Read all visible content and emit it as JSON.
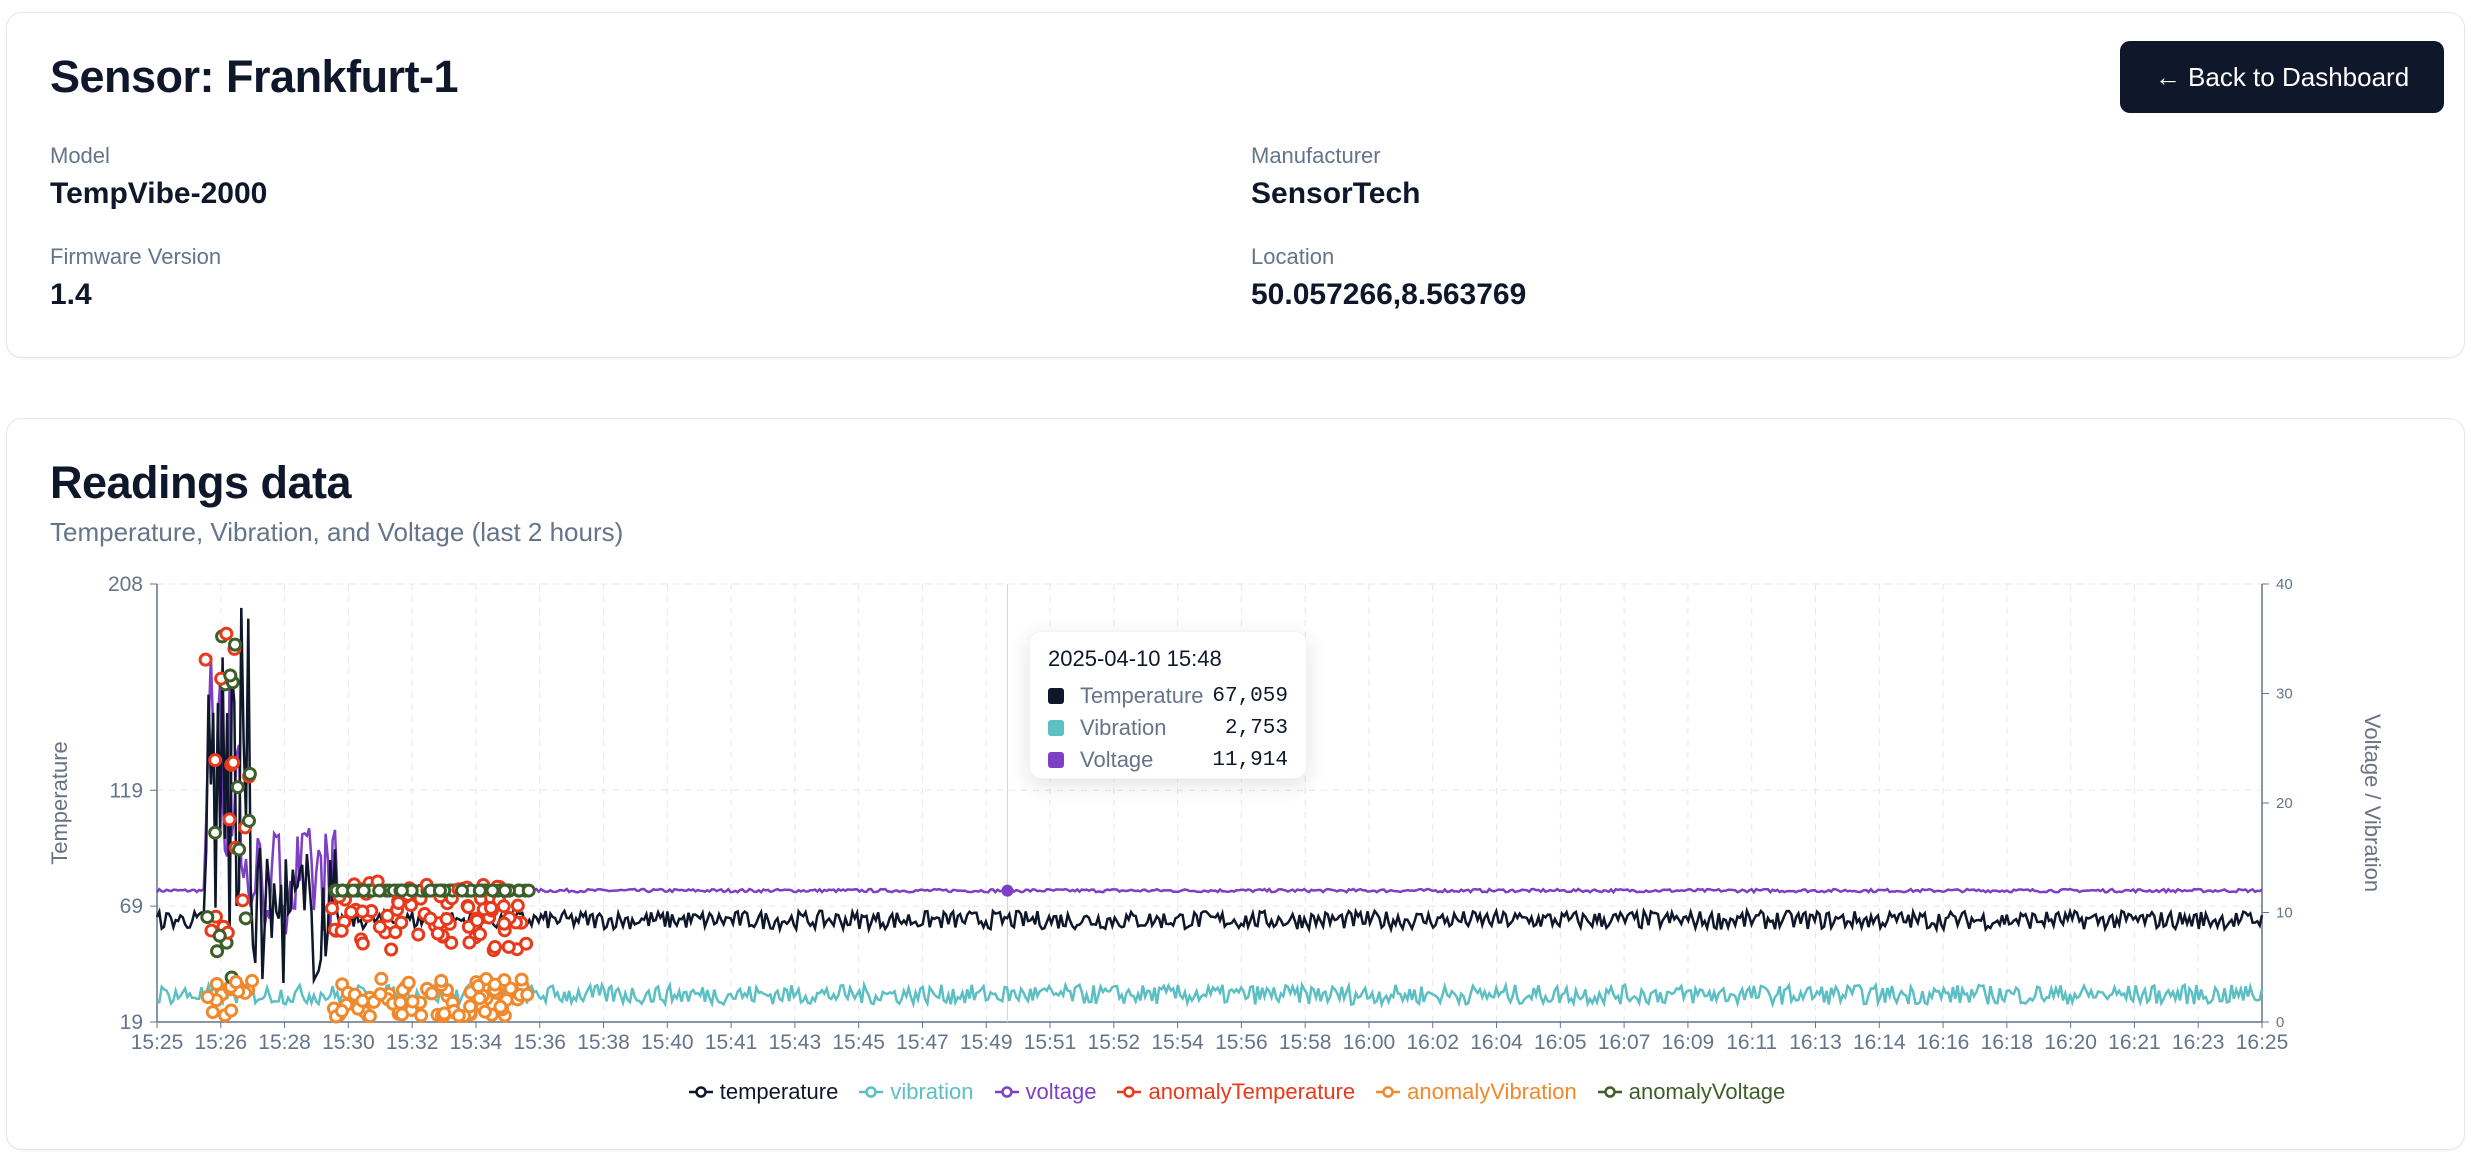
{
  "sensor": {
    "title": "Sensor: Frankfurt-1",
    "back_label": "← Back to Dashboard",
    "fields": {
      "model": {
        "label": "Model",
        "value": "TempVibe-2000"
      },
      "manufacturer": {
        "label": "Manufacturer",
        "value": "SensorTech"
      },
      "firmware": {
        "label": "Firmware Version",
        "value": "1.4"
      },
      "location": {
        "label": "Location",
        "value": "50.057266,8.563769"
      }
    }
  },
  "readings": {
    "title": "Readings data",
    "subtitle": "Temperature, Vibration, and Voltage (last 2 hours)"
  },
  "chart_data": {
    "type": "line",
    "ylabel_left": "Temperature",
    "ylabel_right": "Voltage / Vibration",
    "y_left_ticks": [
      "208",
      "119",
      "69",
      "19"
    ],
    "y_right_ticks": [
      "40",
      "30",
      "20",
      "10",
      "0"
    ],
    "ylim_left": [
      19,
      208
    ],
    "ylim_right": [
      0,
      40
    ],
    "x_ticks": [
      "15:25",
      "15:26",
      "15:28",
      "15:30",
      "15:32",
      "15:34",
      "15:36",
      "15:38",
      "15:40",
      "15:41",
      "15:43",
      "15:45",
      "15:47",
      "15:49",
      "15:51",
      "15:52",
      "15:54",
      "15:56",
      "15:58",
      "16:00",
      "16:02",
      "16:04",
      "16:05",
      "16:07",
      "16:09",
      "16:11",
      "16:13",
      "16:14",
      "16:16",
      "16:18",
      "16:20",
      "16:21",
      "16:23",
      "16:25"
    ],
    "grid": true,
    "series": [
      {
        "name": "temperature",
        "color": "#0f172a",
        "axis": "left",
        "approx_level": 63,
        "noise": 4
      },
      {
        "name": "vibration",
        "color": "#5bbfc4",
        "axis": "right",
        "approx_level": 2.5,
        "noise": 0.9
      },
      {
        "name": "voltage",
        "color": "#7e3fc4",
        "axis": "right",
        "approx_level": 12,
        "noise": 0.15
      },
      {
        "name": "anomalyTemperature",
        "color": "#e8391b",
        "axis": "left"
      },
      {
        "name": "anomalyVibration",
        "color": "#f0882c",
        "axis": "right"
      },
      {
        "name": "anomalyVoltage",
        "color": "#3c5e28",
        "axis": "right"
      }
    ],
    "tooltip": {
      "title": "2025-04-10 15:48",
      "rows": [
        {
          "name": "Temperature",
          "value": "67,059",
          "color": "#0f172a"
        },
        {
          "name": "Vibration",
          "value": "2,753",
          "color": "#5bbfc4"
        },
        {
          "name": "Voltage",
          "value": "11,914",
          "color": "#7e3fc4"
        }
      ]
    },
    "legend": [
      {
        "name": "temperature",
        "color": "#0f172a",
        "text_color": "#0f172a"
      },
      {
        "name": "vibration",
        "color": "#5bbfc4",
        "text_color": "#5bbfc4"
      },
      {
        "name": "voltage",
        "color": "#7e3fc4",
        "text_color": "#7e3fc4"
      },
      {
        "name": "anomalyTemperature",
        "color": "#e8391b",
        "text_color": "#e8391b"
      },
      {
        "name": "anomalyVibration",
        "color": "#f0882c",
        "text_color": "#f0882c"
      },
      {
        "name": "anomalyVoltage",
        "color": "#3c5e28",
        "text_color": "#3c5e28"
      }
    ]
  }
}
